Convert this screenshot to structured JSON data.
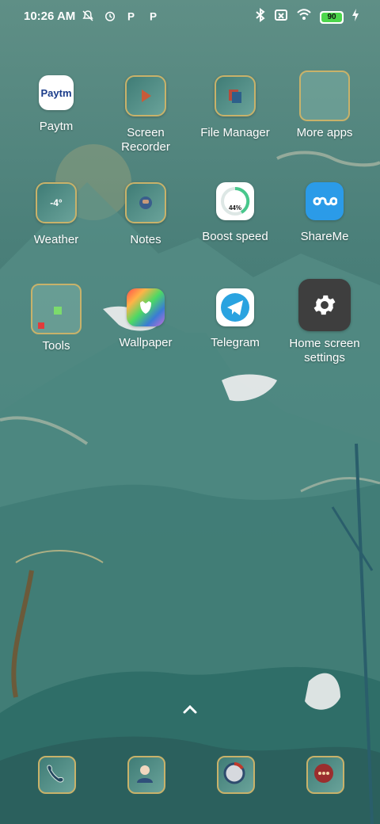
{
  "status_bar": {
    "time": "10:26 AM",
    "battery_level": "90",
    "left_icons": [
      "silent-icon",
      "alarm-icon",
      "p-icon",
      "p-icon"
    ],
    "right_icons": [
      "bluetooth-icon",
      "sim-off-icon",
      "wifi-icon",
      "battery-icon",
      "charging-icon"
    ]
  },
  "apps": [
    {
      "label": "Paytm"
    },
    {
      "label": "Screen Recorder",
      "line1": "Screen",
      "line2": "Recorder"
    },
    {
      "label": "File Manager"
    },
    {
      "label": "More apps"
    },
    {
      "label": "Weather",
      "icon_text": "-4°"
    },
    {
      "label": "Notes"
    },
    {
      "label": "Boost speed",
      "icon_text": "44%"
    },
    {
      "label": "ShareMe"
    },
    {
      "label": "Tools"
    },
    {
      "label": "Wallpaper"
    },
    {
      "label": "Telegram"
    },
    {
      "label": "Home screen settings",
      "line1": "Home screen",
      "line2": "settings"
    }
  ],
  "paytm_logo_text": "Paytm",
  "dock": [
    "phone-app",
    "contacts-app",
    "browser-app",
    "messages-app"
  ],
  "colors": {
    "gold_border": "#c8b26a",
    "teal": "#4a7f79",
    "battery_green": "#4cd64c",
    "telegram_blue": "#2aa3e0",
    "shareme_blue": "#2b9be8"
  }
}
